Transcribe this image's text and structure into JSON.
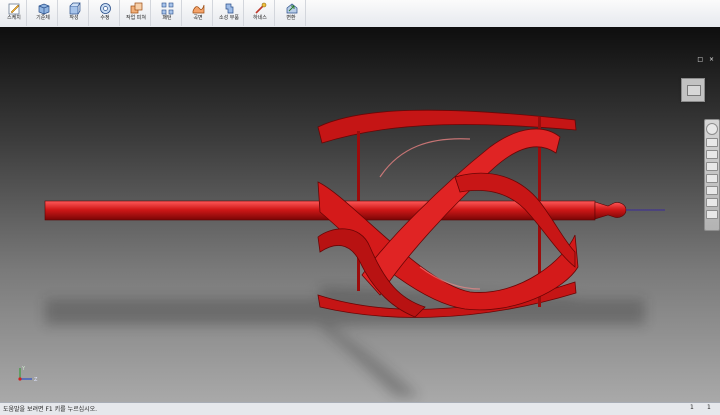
{
  "ribbon": {
    "tools": [
      {
        "label": "스케치",
        "icon": "sketch-icon"
      },
      {
        "label": "기준체",
        "icon": "box-primitive-icon"
      },
      {
        "label": "작성",
        "icon": "extrude-icon"
      },
      {
        "label": "수정",
        "icon": "modify-icon"
      },
      {
        "label": "작업 피쳐",
        "icon": "work-feature-icon"
      },
      {
        "label": "패턴",
        "icon": "pattern-icon"
      },
      {
        "label": "곡면",
        "icon": "surface-icon"
      },
      {
        "label": "소성 부품",
        "icon": "plastic-part-icon"
      },
      {
        "label": "하네스",
        "icon": "harness-icon"
      },
      {
        "label": "변환",
        "icon": "convert-icon"
      }
    ]
  },
  "window_controls": "□ ×",
  "axis_triad": {
    "x": "X",
    "y": "Y",
    "z": "Z"
  },
  "statusbar": {
    "help_text": "도움말을 보려면 F1 키를 누르십시오.",
    "num1": "1",
    "num2": "1"
  },
  "colors": {
    "model_red": "#d01818",
    "model_dark": "#7a0606",
    "model_highlight": "#ff6a6a"
  }
}
